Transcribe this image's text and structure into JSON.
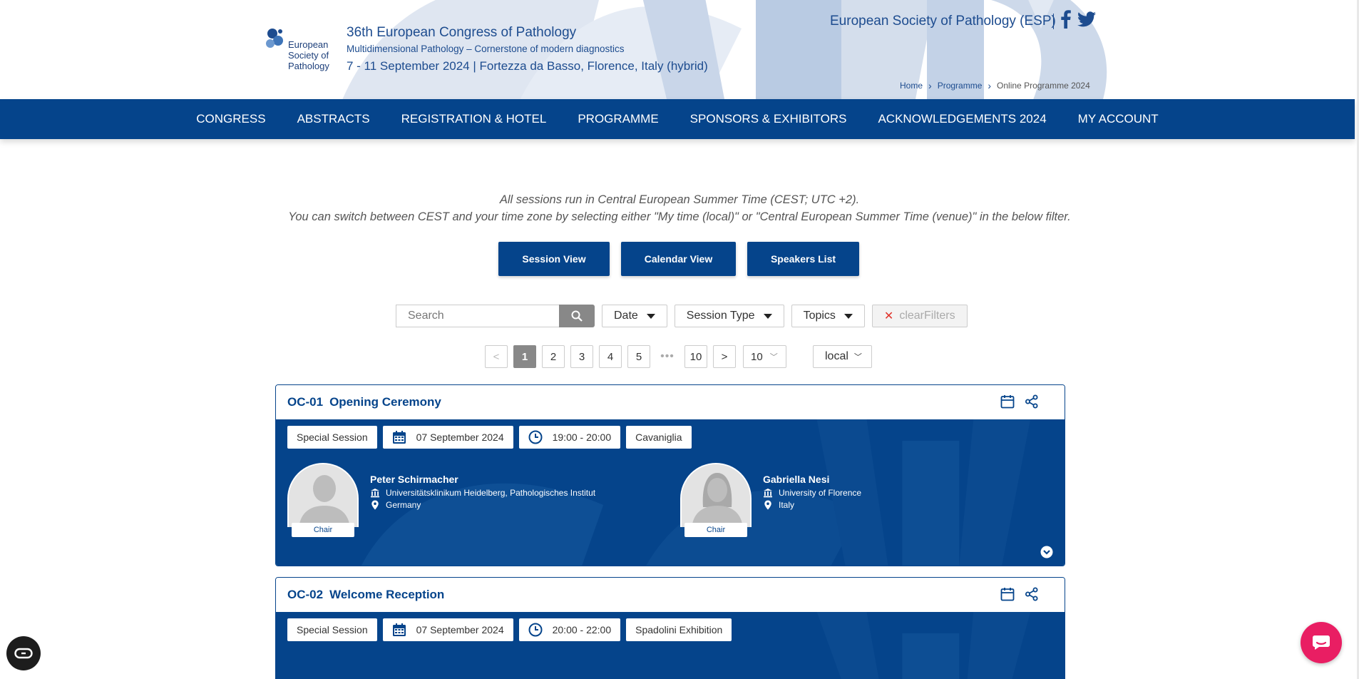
{
  "header": {
    "logo_lines": [
      "European",
      "Society of",
      "Pathology"
    ],
    "congress_title": "36th European Congress of Pathology",
    "congress_subtitle": "Multidimensional Pathology – Cornerstone of modern diagnostics",
    "congress_dates": "7 - 11 September 2024 | Fortezza da Basso, Florence, Italy (hybrid)",
    "esp_link": "European Society of Pathology (ESP)",
    "breadcrumb": [
      "Home",
      "Programme",
      "Online Programme 2024"
    ]
  },
  "nav": {
    "items": [
      "CONGRESS",
      "ABSTRACTS",
      "REGISTRATION & HOTEL",
      "PROGRAMME",
      "SPONSORS & EXHIBITORS",
      "ACKNOWLEDGEMENTS 2024",
      "MY ACCOUNT"
    ]
  },
  "intro": {
    "line1": "All sessions run in Central European Summer Time (CEST; UTC +2).",
    "line2": "You can switch between CEST and your time zone by selecting either \"My time (local)\" or \"Central European Summer Time (venue)\" in the below filter."
  },
  "views": {
    "session_view": "Session View",
    "calendar_view": "Calendar View",
    "speakers_list": "Speakers List"
  },
  "filters": {
    "search_placeholder": "Search",
    "date": "Date",
    "session_type": "Session Type",
    "topics": "Topics",
    "clear": "clearFilters"
  },
  "pagination": {
    "prev": "<",
    "pages": [
      "1",
      "2",
      "3",
      "4",
      "5"
    ],
    "ellipsis": "•••",
    "last": "10",
    "next": ">",
    "page_size": "10",
    "timezone": "local"
  },
  "sessions": [
    {
      "code": "OC-01",
      "title": "Opening Ceremony",
      "type": "Special Session",
      "date": "07 September 2024",
      "time": "19:00 - 20:00",
      "room": "Cavaniglia",
      "speakers": [
        {
          "name": "Peter Schirmacher",
          "institution": "Universitätsklinikum Heidelberg, Pathologisches Institut",
          "country": "Germany",
          "role": "Chair"
        },
        {
          "name": "Gabriella Nesi",
          "institution": "University of Florence",
          "country": "Italy",
          "role": "Chair"
        }
      ]
    },
    {
      "code": "OC-02",
      "title": "Welcome Reception",
      "type": "Special Session",
      "date": "07 September 2024",
      "time": "20:00 - 22:00",
      "room": "Spadolini Exhibition"
    }
  ],
  "colors": {
    "brand": "#05448b",
    "chat": "#e91e63"
  }
}
